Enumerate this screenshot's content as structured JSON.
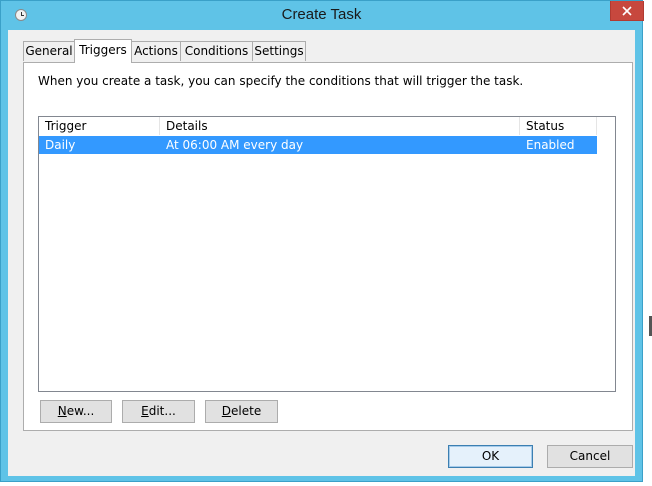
{
  "window": {
    "title": "Create Task",
    "title_icon": "clock-icon",
    "close_icon": "close-icon"
  },
  "tabs": [
    {
      "label": "General",
      "active": false
    },
    {
      "label": "Triggers",
      "active": true
    },
    {
      "label": "Actions",
      "active": false
    },
    {
      "label": "Conditions",
      "active": false
    },
    {
      "label": "Settings",
      "active": false
    }
  ],
  "triggers_tab": {
    "description": "When you create a task, you can specify the conditions that will trigger the task.",
    "columns": [
      "Trigger",
      "Details",
      "Status"
    ],
    "rows": [
      {
        "trigger": "Daily",
        "details": "At 06:00 AM every day",
        "status": "Enabled",
        "selected": true
      }
    ],
    "buttons": {
      "new_mnemonic": "N",
      "new_rest": "ew...",
      "edit_mnemonic": "E",
      "edit_rest": "dit...",
      "delete_mnemonic": "D",
      "delete_rest": "elete"
    }
  },
  "footer": {
    "ok_label": "OK",
    "cancel_label": "Cancel"
  },
  "colors": {
    "titlebar": "#5fc3e7",
    "close": "#c7483e",
    "selection": "#3399ff"
  }
}
